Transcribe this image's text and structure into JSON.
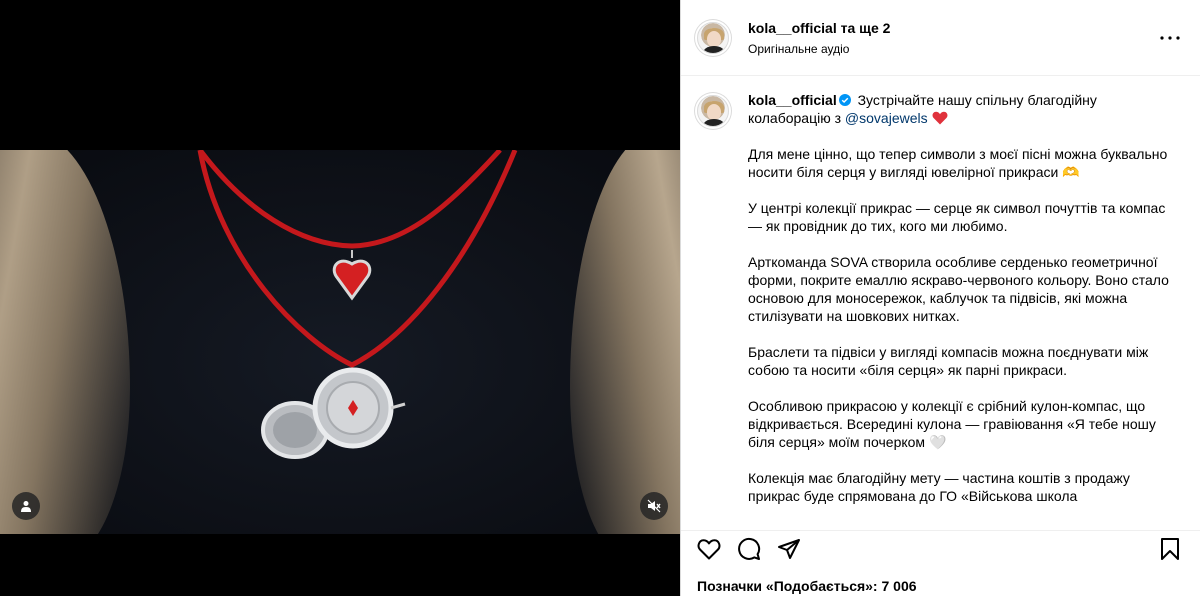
{
  "post": {
    "author": "kola__official",
    "coauthors": "та ще 2",
    "audio": "Оригінальне аудіо"
  },
  "caption": {
    "author": "kola__official",
    "intro": "Зустрічайте нашу спільну благодійну колаборацію з",
    "mention": "@sovajewels",
    "paragraphs": [
      "Для мене цінно, що тепер символи з моєї пісні можна буквально носити біля серця у вигляді ювелірної прикраси 🫶",
      "У центрі колекції прикрас — серце як символ почуттів та компас — як провідник до тих, кого ми любимо.",
      "Арткоманда SOVA створила особливе серденько геометричної форми, покрите емаллю яскраво-червоного кольору. Воно стало основою для моносережок, каблучок та підвісів, які можна стилізувати на шовкових нитках.",
      "Браслети та підвіси у вигляді компасів можна поєднувати між собою та носити «біля серця» як парні прикраси.",
      "Особливою прикрасою у колекції є срібний кулон-компас, що відкривається. Всередині кулона — гравіювання «Я тебе ношу біля серця» моїм почерком 🤍",
      "Колекція має благодійну мету — частина коштів з продажу прикрас буде спрямована до ГО «Військова школа"
    ]
  },
  "likes": {
    "label": "Позначки «Подобається»: 7 006"
  },
  "colors": {
    "mention": "#00376b",
    "verified": "#0095f6",
    "heart": "#e0323c"
  },
  "icons": [
    "user-icon",
    "mute-icon",
    "more-icon",
    "like-icon",
    "comment-icon",
    "share-icon",
    "save-icon",
    "verified-icon",
    "heart-emoji-icon"
  ]
}
